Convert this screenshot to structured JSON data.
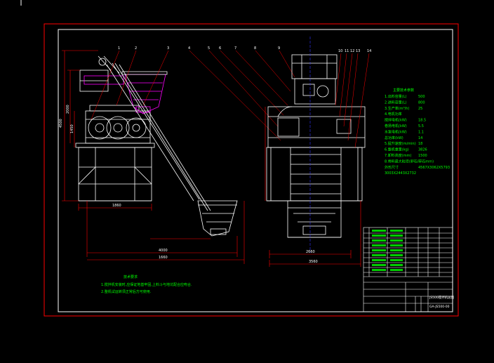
{
  "drawing": {
    "colors": {
      "background": "#000000",
      "frame": "#ff0000",
      "machine": "#ffffff",
      "leaders": "#ff0000",
      "dimensions": "#ff0000",
      "specs_text": "#00ff00",
      "hopper_highlight": "#ff00ff",
      "axis": "#0000ff"
    },
    "balloon_numbers_left": [
      "1",
      "2",
      "3",
      "4",
      "5",
      "6",
      "7",
      "8",
      "9"
    ],
    "balloon_numbers_right": [
      "10",
      "11",
      "12",
      "13",
      "14"
    ],
    "dim_labels": {
      "left_height_overall": "4500",
      "left_height_upper": "2000",
      "left_height_mid": "1450",
      "left_width_base": "1860",
      "left_width_total": "4000",
      "left_width_small": "1660",
      "right_width_base": "2660",
      "right_width_total": "3560"
    },
    "specs": {
      "header": "主要技术参数",
      "rows": [
        {
          "label": "1.出料容量(L)",
          "value": "500"
        },
        {
          "label": "2.进料容量(L)",
          "value": "800"
        },
        {
          "label": "3.生产率(m³/h)",
          "value": "25"
        },
        {
          "label": "4.电机功率",
          "value": ""
        },
        {
          "label": "搅拌电机(kW)",
          "value": "18.5"
        },
        {
          "label": "卷扬电机(kW)",
          "value": "5.5"
        },
        {
          "label": "水泵电机(kW)",
          "value": "1.1"
        },
        {
          "label": "总功率(kW)",
          "value": "14"
        },
        {
          "label": "5.提升速度(m/min)",
          "value": "18"
        },
        {
          "label": "6.整机重量(kg)",
          "value": "3826"
        },
        {
          "label": "7.卸料高度(mm)",
          "value": "1500"
        },
        {
          "label": "8.骨料最大粒径(卵石/碎石mm)",
          "value": ""
        },
        {
          "label": "外形尺寸",
          "value": "4567X3062X5793"
        },
        {
          "label": "",
          "value": "3003X2443X2732"
        }
      ]
    },
    "notes": {
      "title": "技术要求",
      "lines": [
        "1.搅拌机安装时,应保证地基牢固,上料斗与地坑配合应吻合.",
        "2.整机试运转须正常后方可使用."
      ]
    },
    "title_block": {
      "drawing_name": "JS500搅拌机总图",
      "drawing_number": "GA-JS500-00"
    }
  }
}
